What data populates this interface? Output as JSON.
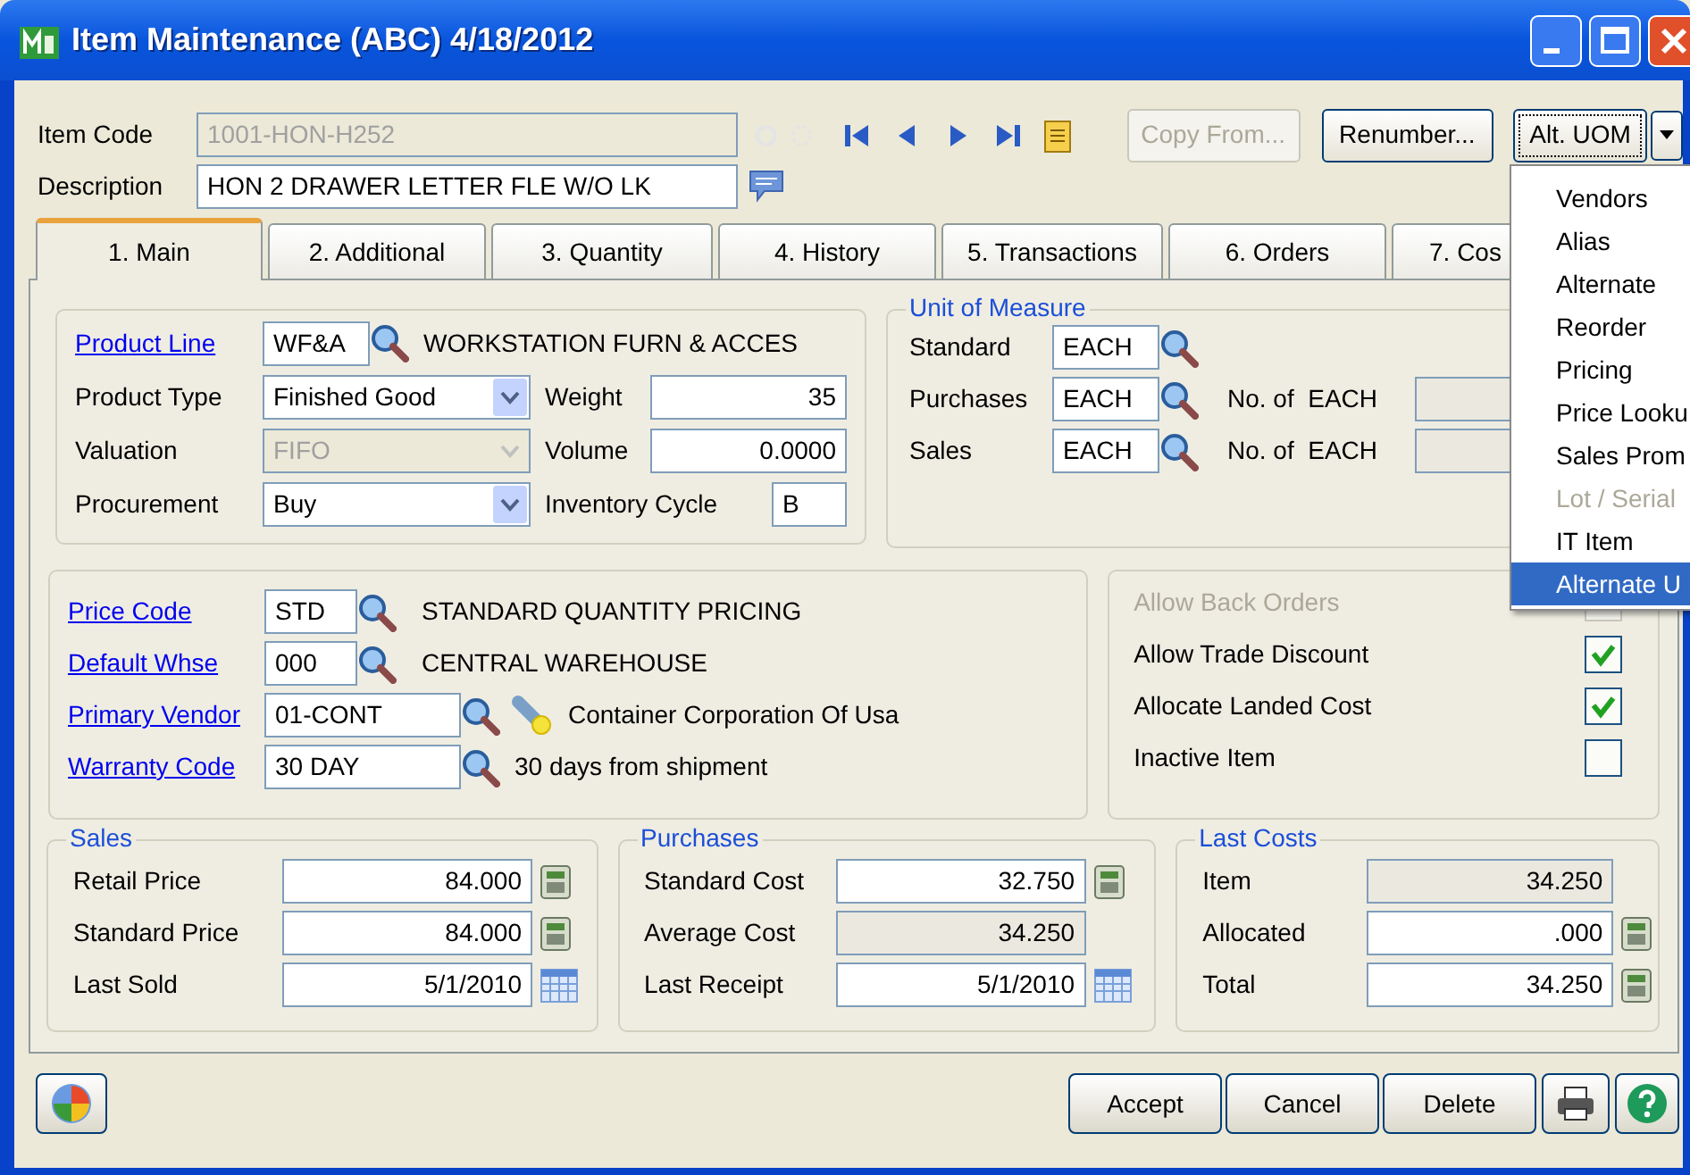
{
  "window": {
    "title": "Item Maintenance (ABC) 4/18/2012"
  },
  "header": {
    "item_code": {
      "label": "Item Code",
      "value": "1001-HON-H252",
      "disabled": true
    },
    "description": {
      "label": "Description",
      "value": "HON 2 DRAWER LETTER FLE W/O LK"
    },
    "buttons": [
      {
        "label": "Copy From...",
        "disabled": true
      },
      {
        "label": "Renumber...",
        "disabled": false
      },
      {
        "label": "Alt. UOM",
        "disabled": false
      }
    ]
  },
  "tabs": [
    {
      "label": "1. Main",
      "selected": true
    },
    {
      "label": "2. Additional",
      "selected": false
    },
    {
      "label": "3. Quantity",
      "selected": false
    },
    {
      "label": "4. History",
      "selected": false
    },
    {
      "label": "5. Transactions",
      "selected": false
    },
    {
      "label": "6. Orders",
      "selected": false
    },
    {
      "label": "7. Cos",
      "selected": false
    }
  ],
  "general": {
    "product_line": {
      "label": "Product Line",
      "value": "WF&A",
      "description": "WORKSTATION FURN & ACCES"
    },
    "product_type": {
      "label": "Product Type",
      "value": "Finished Good",
      "disabled": false
    },
    "valuation": {
      "label": "Valuation",
      "value": "FIFO",
      "disabled": true
    },
    "procurement": {
      "label": "Procurement",
      "value": "Buy",
      "disabled": false
    },
    "weight": {
      "label": "Weight",
      "value": "35"
    },
    "volume": {
      "label": "Volume",
      "value": "0.0000"
    },
    "inventory_cycle": {
      "label": "Inventory Cycle",
      "value": "B"
    }
  },
  "unit_of_measure": {
    "title": "Unit of Measure",
    "rows": [
      {
        "label": "Standard",
        "value": "EACH"
      },
      {
        "label": "Purchases",
        "value": "EACH",
        "conversion_label": "No. of  EACH"
      },
      {
        "label": "Sales",
        "value": "EACH",
        "conversion_label": "No. of  EACH"
      }
    ]
  },
  "codes": [
    {
      "label": "Price Code",
      "value": "STD",
      "description": "STANDARD QUANTITY PRICING",
      "kind": "short"
    },
    {
      "label": "Default Whse",
      "value": "000",
      "description": "CENTRAL WAREHOUSE",
      "kind": "short"
    },
    {
      "label": "Primary Vendor",
      "value": "01-CONT",
      "description": "Container Corporation Of Usa",
      "kind": "vendor"
    },
    {
      "label": "Warranty Code",
      "value": "30 DAY",
      "description": "30 days from shipment",
      "kind": "long"
    }
  ],
  "options": [
    {
      "label": "Allow Back Orders",
      "checked": false,
      "disabled": true
    },
    {
      "label": "Allow Trade Discount",
      "checked": true,
      "disabled": false
    },
    {
      "label": "Allocate Landed Cost",
      "checked": true,
      "disabled": false
    },
    {
      "label": "Inactive Item",
      "checked": false,
      "disabled": false
    }
  ],
  "price_groups": [
    {
      "title": "Sales",
      "rows": [
        {
          "label": "Retail Price",
          "value": "84.000",
          "kind": "calculator",
          "readonly": false
        },
        {
          "label": "Standard Price",
          "value": "84.000",
          "kind": "calculator",
          "readonly": false
        },
        {
          "label": "Last Sold",
          "value": "5/1/2010",
          "kind": "calendar",
          "readonly": false
        }
      ]
    },
    {
      "title": "Purchases",
      "rows": [
        {
          "label": "Standard Cost",
          "value": "32.750",
          "kind": "calculator",
          "readonly": false
        },
        {
          "label": "Average Cost",
          "value": "34.250",
          "kind": "none",
          "readonly": true
        },
        {
          "label": "Last Receipt",
          "value": "5/1/2010",
          "kind": "calendar",
          "readonly": false
        }
      ]
    },
    {
      "title": "Last Costs",
      "rows": [
        {
          "label": "Item",
          "value": "34.250",
          "kind": "none",
          "readonly": true
        },
        {
          "label": "Allocated",
          "value": ".000",
          "kind": "calculator",
          "readonly": false
        },
        {
          "label": "Total",
          "value": "34.250",
          "kind": "calculator",
          "readonly": false
        }
      ]
    }
  ],
  "footer_buttons": [
    {
      "label": "Accept"
    },
    {
      "label": "Cancel"
    },
    {
      "label": "Delete"
    }
  ],
  "menu": {
    "items": [
      {
        "label": "Vendors",
        "selected": false,
        "disabled": false
      },
      {
        "label": "Alias",
        "selected": false,
        "disabled": false
      },
      {
        "label": "Alternate",
        "selected": false,
        "disabled": false
      },
      {
        "label": "Reorder",
        "selected": false,
        "disabled": false
      },
      {
        "label": "Pricing",
        "selected": false,
        "disabled": false
      },
      {
        "label": "Price Looku",
        "selected": false,
        "disabled": false
      },
      {
        "label": "Sales Prom",
        "selected": false,
        "disabled": false
      },
      {
        "label": "Lot / Serial",
        "selected": false,
        "disabled": true
      },
      {
        "label": "IT Item",
        "selected": false,
        "disabled": false
      },
      {
        "label": "Alternate U",
        "selected": true,
        "disabled": false
      }
    ]
  }
}
